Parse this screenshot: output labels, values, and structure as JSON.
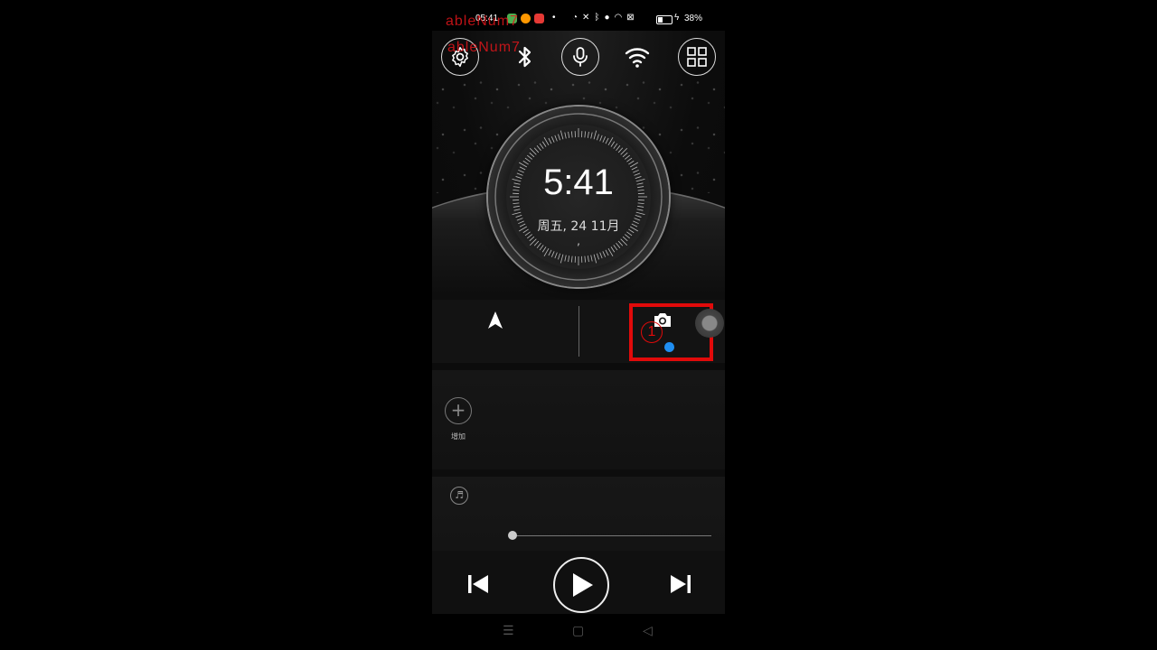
{
  "status_bar": {
    "time": "05:41",
    "battery_percent": "38%",
    "app_icon_colors": [
      "#4caf50",
      "#ff9800",
      "#e53935"
    ],
    "dot": "•",
    "charge_symbol": "ϟ"
  },
  "overlay": {
    "line1": "ableNum7",
    "line2": "ableNum7"
  },
  "quick_buttons": [
    {
      "name": "settings",
      "icon": "gear-icon"
    },
    {
      "name": "bluetooth",
      "icon": "bluetooth-icon"
    },
    {
      "name": "microphone",
      "icon": "mic-icon"
    },
    {
      "name": "wifi",
      "icon": "wifi-icon"
    },
    {
      "name": "apps",
      "icon": "grid-icon"
    }
  ],
  "clock": {
    "time": "5:41",
    "date": "周五, 24 11月",
    "sub": ","
  },
  "shortcuts": {
    "left_icon": "navigation-arrow-icon",
    "right_icon": "camera-icon",
    "annotation_number": "1",
    "highlight_color": "#e10a0a",
    "badge_color": "#1f8ef1"
  },
  "widget": {
    "add_label": "增加"
  },
  "music": {
    "progress": 0.0,
    "note_glyph": "♬"
  },
  "navbar": {
    "menu": "☰",
    "home": "▢",
    "back": "◁"
  }
}
